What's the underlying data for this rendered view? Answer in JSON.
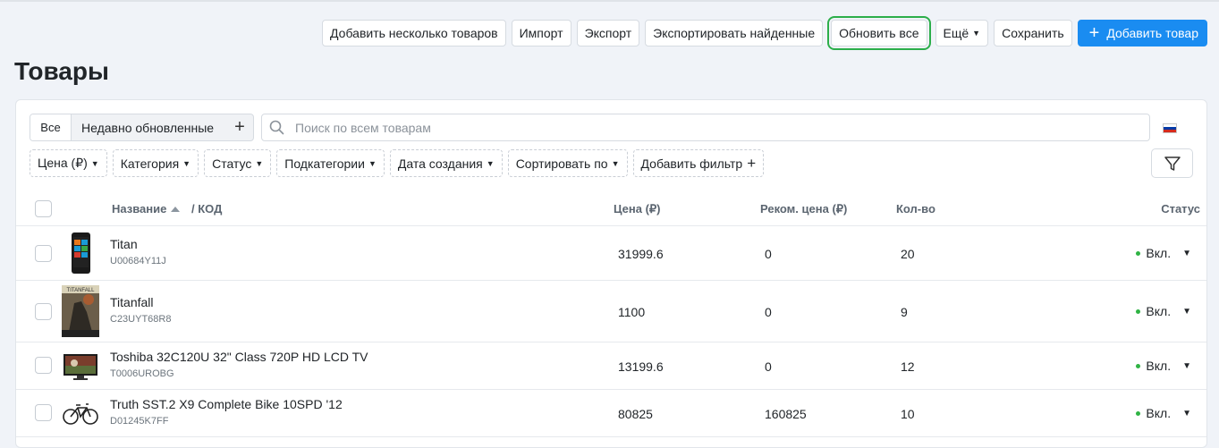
{
  "toolbar": {
    "add_multiple": "Добавить несколько товаров",
    "import": "Импорт",
    "export": "Экспорт",
    "export_found": "Экспортировать найденные",
    "update_all": "Обновить все",
    "more": "Ещё",
    "save": "Сохранить",
    "add_product": "Добавить товар"
  },
  "page_title": "Товары",
  "tabs": {
    "all": "Все",
    "recent": "Недавно обновленные",
    "add": "+"
  },
  "search": {
    "placeholder": "Поиск по всем товарам",
    "value": ""
  },
  "language": {
    "flag": "ru",
    "colors": [
      "#ffffff",
      "#0039a6",
      "#d52b1e"
    ]
  },
  "filters": {
    "price": "Цена (₽)",
    "category": "Категория",
    "status": "Статус",
    "subcategories": "Подкатегории",
    "created": "Дата создания",
    "sort": "Сортировать по",
    "add_filter": "Добавить фильтр"
  },
  "table": {
    "headers": {
      "name": "Название",
      "code": "/  КОД",
      "price": "Цена (₽)",
      "rec_price": "Реком. цена (₽)",
      "qty": "Кол-во",
      "status": "Статус"
    },
    "rows": [
      {
        "name": "Titan",
        "code": "U00684Y11J",
        "price": "31999.6",
        "rec_price": "0",
        "qty": "20",
        "status": "Вкл."
      },
      {
        "name": "Titanfall",
        "code": "C23UYT68R8",
        "price": "1100",
        "rec_price": "0",
        "qty": "9",
        "status": "Вкл."
      },
      {
        "name": "Toshiba 32C120U 32\" Class 720P HD LCD TV",
        "code": "T0006UROBG",
        "price": "13199.6",
        "rec_price": "0",
        "qty": "12",
        "status": "Вкл."
      },
      {
        "name": "Truth SST.2 X9 Complete Bike 10SPD '12",
        "code": "D01245K7FF",
        "price": "80825",
        "rec_price": "160825",
        "qty": "10",
        "status": "Вкл."
      }
    ]
  },
  "colors": {
    "accent": "#1a8cf1",
    "status_on": "#2fb344",
    "highlight": "#2cae4a"
  }
}
